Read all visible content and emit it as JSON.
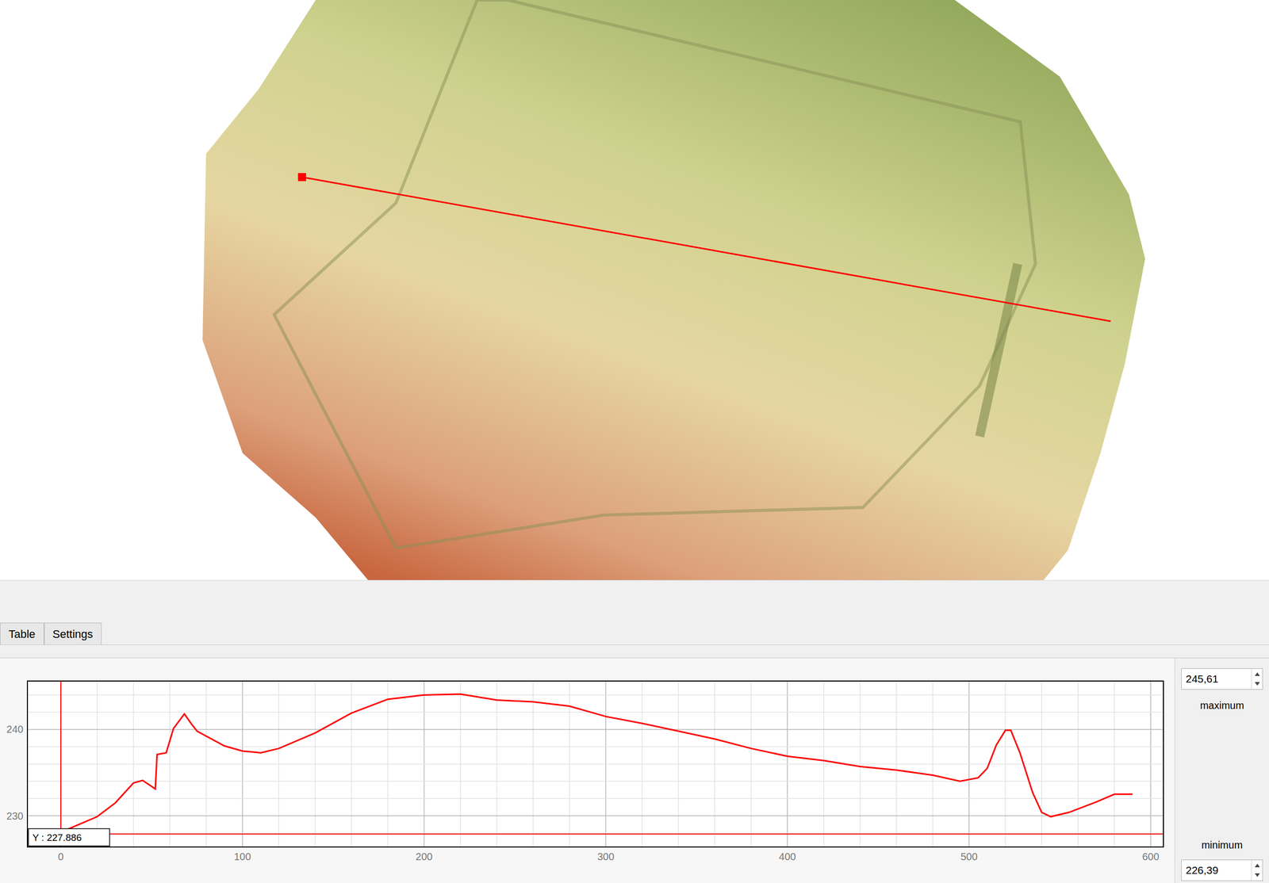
{
  "tabs": [
    {
      "label": "Table",
      "selected": false
    },
    {
      "label": "Settings",
      "selected": false
    }
  ],
  "chart": {
    "y_ticks": [
      "230",
      "240"
    ],
    "x_ticks": [
      "0",
      "100",
      "200",
      "300",
      "400",
      "500",
      "600"
    ],
    "series": [
      {
        "distances": [
          0,
          10,
          20,
          30,
          40,
          45,
          50,
          52,
          53,
          58,
          62,
          68,
          72,
          75,
          90,
          100,
          110,
          120,
          140,
          160,
          180,
          200,
          220,
          240,
          260,
          280,
          300,
          320,
          340,
          360,
          380,
          400,
          420,
          440,
          460,
          480,
          495,
          505,
          510,
          515,
          520,
          523,
          528,
          535,
          540,
          545,
          555,
          570,
          580,
          590
        ],
        "values": [
          228.1,
          229.0,
          229.9,
          231.5,
          233.8,
          234.1,
          233.4,
          233.1,
          237.1,
          237.3,
          240.1,
          241.8,
          240.6,
          239.8,
          238.1,
          237.5,
          237.3,
          237.8,
          239.6,
          241.9,
          243.5,
          244.0,
          244.1,
          243.4,
          243.2,
          242.7,
          241.5,
          240.7,
          239.8,
          238.9,
          237.8,
          236.9,
          236.4,
          235.7,
          235.3,
          234.7,
          234.0,
          234.4,
          235.5,
          238.2,
          239.9,
          239.9,
          237.3,
          232.7,
          230.4,
          229.9,
          230.4,
          231.6,
          232.5,
          232.5
        ]
      }
    ],
    "cursor": {
      "distance": 0,
      "value": 227.886,
      "label": "Y : 227.886"
    }
  },
  "range": {
    "maximum": {
      "label": "maximum",
      "value": "245,61"
    },
    "minimum": {
      "label": "minimum",
      "value": "226,39"
    }
  }
}
